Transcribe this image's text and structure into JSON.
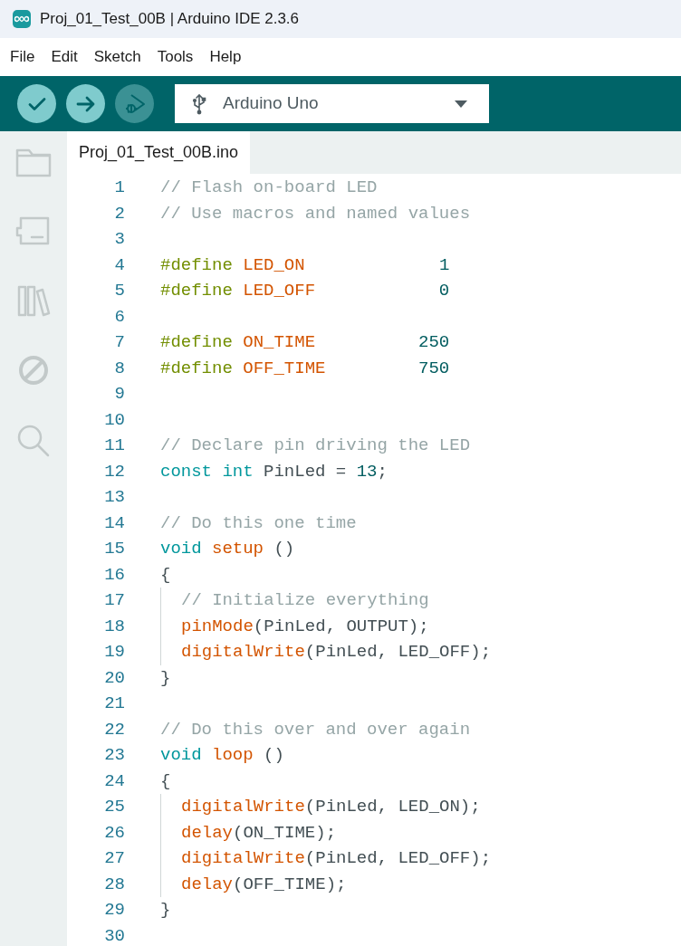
{
  "window": {
    "title": "Proj_01_Test_00B | Arduino IDE 2.3.6"
  },
  "menu": [
    "File",
    "Edit",
    "Sketch",
    "Tools",
    "Help"
  ],
  "toolbar": {
    "buttons": [
      {
        "kind": "verify",
        "disabled": false
      },
      {
        "kind": "upload",
        "disabled": false
      },
      {
        "kind": "debug",
        "disabled": true
      }
    ],
    "board": "Arduino Uno"
  },
  "sidebar": {
    "items": [
      {
        "kind": "folder"
      },
      {
        "kind": "board"
      },
      {
        "kind": "library"
      },
      {
        "kind": "debug"
      },
      {
        "kind": "search"
      }
    ]
  },
  "tabs": [
    {
      "label": "Proj_01_Test_00B.ino",
      "selected": true
    }
  ],
  "editor": {
    "lines": [
      {
        "number": "1",
        "indented": false,
        "tokens": [
          {
            "text": "// Flash on-board LED",
            "kind": "comment"
          }
        ]
      },
      {
        "number": "2",
        "indented": false,
        "tokens": [
          {
            "text": "// Use macros and named values",
            "kind": "comment"
          }
        ]
      },
      {
        "number": "3",
        "indented": false
      },
      {
        "number": "4",
        "indented": false,
        "tokens": [
          {
            "text": "#define",
            "kind": "directive"
          },
          {
            "text": " LED_ON",
            "kind": "macro"
          },
          {
            "text": "             1",
            "kind": "number"
          }
        ]
      },
      {
        "number": "5",
        "indented": false,
        "tokens": [
          {
            "text": "#define",
            "kind": "directive"
          },
          {
            "text": " LED_OFF",
            "kind": "macro"
          },
          {
            "text": "            0",
            "kind": "number"
          }
        ]
      },
      {
        "number": "6",
        "indented": false
      },
      {
        "number": "7",
        "indented": false,
        "tokens": [
          {
            "text": "#define",
            "kind": "directive"
          },
          {
            "text": " ON_TIME",
            "kind": "macro"
          },
          {
            "text": "          250",
            "kind": "number"
          }
        ]
      },
      {
        "number": "8",
        "indented": false,
        "tokens": [
          {
            "text": "#define",
            "kind": "directive"
          },
          {
            "text": " OFF_TIME",
            "kind": "macro"
          },
          {
            "text": "         750",
            "kind": "number"
          }
        ]
      },
      {
        "number": "9",
        "indented": false
      },
      {
        "number": "10",
        "indented": false
      },
      {
        "number": "11",
        "indented": false,
        "tokens": [
          {
            "text": "// Declare pin driving the LED",
            "kind": "comment"
          }
        ]
      },
      {
        "number": "12",
        "indented": false,
        "tokens": [
          {
            "text": "const int",
            "kind": "keyword"
          },
          {
            "text": " PinLed = ",
            "kind": "plain"
          },
          {
            "text": "13",
            "kind": "number"
          },
          {
            "text": ";",
            "kind": "plain"
          }
        ]
      },
      {
        "number": "13",
        "indented": false
      },
      {
        "number": "14",
        "indented": false,
        "tokens": [
          {
            "text": "// Do this one time",
            "kind": "comment"
          }
        ]
      },
      {
        "number": "15",
        "indented": false,
        "tokens": [
          {
            "text": "void",
            "kind": "keyword"
          },
          {
            "text": " setup",
            "kind": "function"
          },
          {
            "text": " ()",
            "kind": "plain"
          }
        ]
      },
      {
        "number": "16",
        "indented": false,
        "tokens": [
          {
            "text": "{",
            "kind": "plain"
          }
        ]
      },
      {
        "number": "17",
        "indented": true,
        "tokens": [
          {
            "text": "// Initialize everything",
            "kind": "comment"
          }
        ]
      },
      {
        "number": "18",
        "indented": true,
        "tokens": [
          {
            "text": "pinMode",
            "kind": "function"
          },
          {
            "text": "(PinLed, OUTPUT);",
            "kind": "plain"
          }
        ]
      },
      {
        "number": "19",
        "indented": true,
        "tokens": [
          {
            "text": "digitalWrite",
            "kind": "function"
          },
          {
            "text": "(PinLed, LED_OFF);",
            "kind": "plain"
          }
        ]
      },
      {
        "number": "20",
        "indented": false,
        "tokens": [
          {
            "text": "}",
            "kind": "plain"
          }
        ]
      },
      {
        "number": "21",
        "indented": false
      },
      {
        "number": "22",
        "indented": false,
        "tokens": [
          {
            "text": "// Do this over and over again",
            "kind": "comment"
          }
        ]
      },
      {
        "number": "23",
        "indented": false,
        "tokens": [
          {
            "text": "void",
            "kind": "keyword"
          },
          {
            "text": " loop",
            "kind": "function"
          },
          {
            "text": " ()",
            "kind": "plain"
          }
        ]
      },
      {
        "number": "24",
        "indented": false,
        "tokens": [
          {
            "text": "{",
            "kind": "plain"
          }
        ]
      },
      {
        "number": "25",
        "indented": true,
        "tokens": [
          {
            "text": "digitalWrite",
            "kind": "function"
          },
          {
            "text": "(PinLed, LED_ON);",
            "kind": "plain"
          }
        ]
      },
      {
        "number": "26",
        "indented": true,
        "tokens": [
          {
            "text": "delay",
            "kind": "function"
          },
          {
            "text": "(ON_TIME);",
            "kind": "plain"
          }
        ]
      },
      {
        "number": "27",
        "indented": true,
        "tokens": [
          {
            "text": "digitalWrite",
            "kind": "function"
          },
          {
            "text": "(PinLed, LED_OFF);",
            "kind": "plain"
          }
        ]
      },
      {
        "number": "28",
        "indented": true,
        "tokens": [
          {
            "text": "delay",
            "kind": "function"
          },
          {
            "text": "(OFF_TIME);",
            "kind": "plain"
          }
        ]
      },
      {
        "number": "29",
        "indented": false,
        "tokens": [
          {
            "text": "}",
            "kind": "plain"
          }
        ]
      },
      {
        "number": "30",
        "indented": false
      }
    ]
  }
}
